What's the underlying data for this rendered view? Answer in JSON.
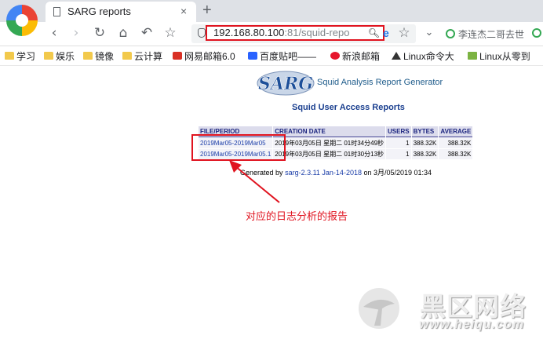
{
  "browser": {
    "tab_title": "SARG reports",
    "tab_close": "×",
    "new_tab": "+",
    "address_host": "192.168.80.100",
    "address_rest": ":81/squid-repo",
    "search_hint": "李连杰二哥去世",
    "nav": {
      "back": "‹",
      "forward": "›",
      "reload": "↻",
      "home": "⌂",
      "undo": "↶",
      "bookmark": "☆",
      "bookmark2": "☆",
      "menu": "⌄"
    }
  },
  "bookmarks": [
    {
      "label": "学习",
      "icon": "folder-icon"
    },
    {
      "label": "娱乐",
      "icon": "folder-icon"
    },
    {
      "label": "镜像",
      "icon": "folder-icon"
    },
    {
      "label": "云计算",
      "icon": "folder-icon"
    },
    {
      "label": "网易邮箱6.0",
      "icon": "mail-icon"
    },
    {
      "label": "百度贴吧——",
      "icon": "baidu-icon"
    },
    {
      "label": "新浪邮箱",
      "icon": "weibo-icon"
    },
    {
      "label": "Linux命令大",
      "icon": "linux-icon"
    },
    {
      "label": "Linux从零到",
      "icon": "book-icon"
    }
  ],
  "page": {
    "logo_text": "SARG",
    "subtitle": "Squid Analysis Report Generator",
    "title": "Squid User Access Reports",
    "table": {
      "headers": [
        "FILE/PERIOD",
        "CREATION DATE",
        "USERS",
        "BYTES",
        "AVERAGE"
      ],
      "rows": [
        {
          "period": "2019Mar05-2019Mar05",
          "created": "2019年03月05日 星期二 01时34分49秒",
          "users": "1",
          "bytes": "388.32K",
          "average": "388.32K"
        },
        {
          "period": "2019Mar05-2019Mar05.1",
          "created": "2019年03月05日 星期二 01时30分13秒",
          "users": "1",
          "bytes": "388.32K",
          "average": "388.32K"
        }
      ]
    },
    "generated_prefix": "Generated by",
    "generated_link": "sarg-2.3.11 Jan-14-2018",
    "generated_suffix": "on 3月/05/2019 01:34"
  },
  "annotation": {
    "text": "对应的日志分析的报告",
    "color": "#e0131f"
  },
  "watermark": {
    "name": "黑区网络",
    "url": "www.heiqu.com"
  }
}
